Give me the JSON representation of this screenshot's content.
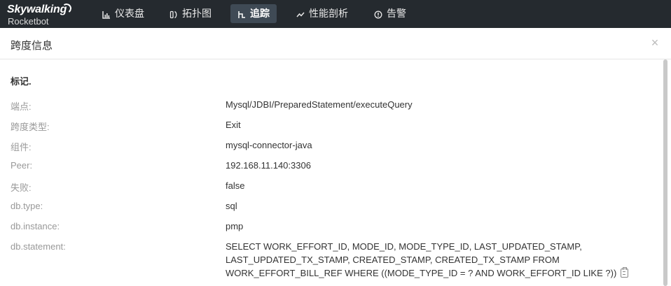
{
  "app": {
    "logo_text": "Skywalking",
    "logo_sub": "Rocketbot"
  },
  "nav": [
    {
      "label": "仪表盘",
      "icon": "dashboard-icon",
      "active": false
    },
    {
      "label": "拓扑图",
      "icon": "topology-icon",
      "active": false
    },
    {
      "label": "追踪",
      "icon": "trace-icon",
      "active": true
    },
    {
      "label": "性能剖析",
      "icon": "profile-icon",
      "active": false
    },
    {
      "label": "告警",
      "icon": "alarm-icon",
      "active": false
    }
  ],
  "dialog": {
    "title": "跨度信息",
    "close_symbol": "×"
  },
  "section": {
    "title": "标记."
  },
  "rows": [
    {
      "key": "端点:",
      "value": "Mysql/JDBI/PreparedStatement/executeQuery"
    },
    {
      "key": "跨度类型:",
      "value": "Exit"
    },
    {
      "key": "组件:",
      "value": "mysql-connector-java"
    },
    {
      "key": "Peer:",
      "value": "192.168.11.140:3306"
    },
    {
      "key": "失败:",
      "value": "false"
    },
    {
      "key": "db.type:",
      "value": "sql"
    },
    {
      "key": "db.instance:",
      "value": "pmp"
    },
    {
      "key": "db.statement:",
      "value": "SELECT WORK_EFFORT_ID, MODE_ID, MODE_TYPE_ID, LAST_UPDATED_STAMP, LAST_UPDATED_TX_STAMP, CREATED_STAMP, CREATED_TX_STAMP FROM WORK_EFFORT_BILL_REF WHERE ((MODE_TYPE_ID = ? AND WORK_EFFORT_ID LIKE ?))"
    }
  ],
  "colors": {
    "topbar": "#252a2f",
    "active_nav": "#3f4a55",
    "key_text": "#999999",
    "value_text": "#333333"
  }
}
